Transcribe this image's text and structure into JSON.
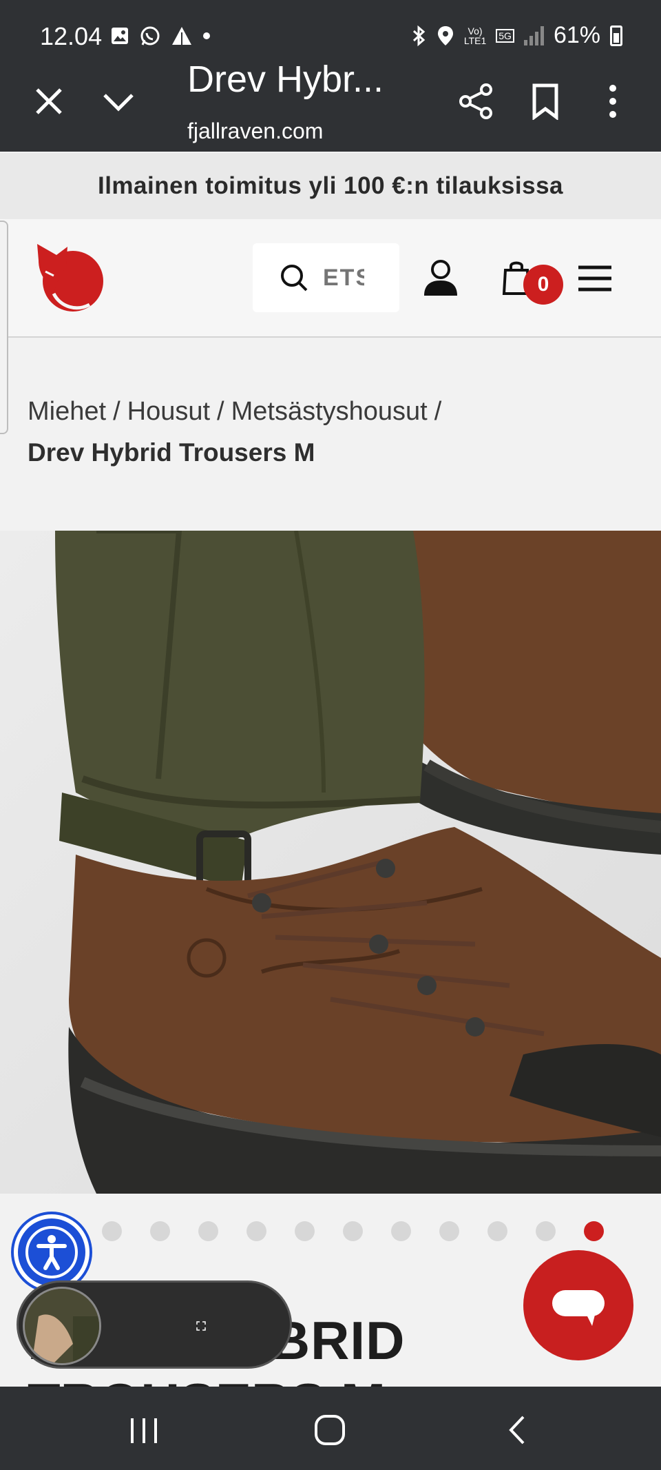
{
  "status_bar": {
    "time": "12.04",
    "network_label_top": "Vo)",
    "network_label_bottom": "LTE1",
    "network_5g": "5G",
    "battery": "61%"
  },
  "browser": {
    "title": "Drev Hybr...",
    "url": "fjallraven.com"
  },
  "promo": {
    "text": "Ilmainen toimitus yli 100 €:n tilauksissa"
  },
  "header": {
    "search_placeholder": "ETSI",
    "cart_count": "0"
  },
  "breadcrumb": {
    "items": [
      "Miehet",
      "Housut",
      "Metsästyshousut"
    ],
    "separator": "/",
    "current": "Drev Hybrid Trousers M"
  },
  "carousel": {
    "total": 11,
    "active_index": 10
  },
  "product": {
    "heading_line1": "DREV HYBRID",
    "heading_line2": "TROUSERS M"
  },
  "colors": {
    "brand_red": "#cc1f1f",
    "accessibility_blue": "#1c4fd6",
    "system_bar": "#2f3134"
  }
}
